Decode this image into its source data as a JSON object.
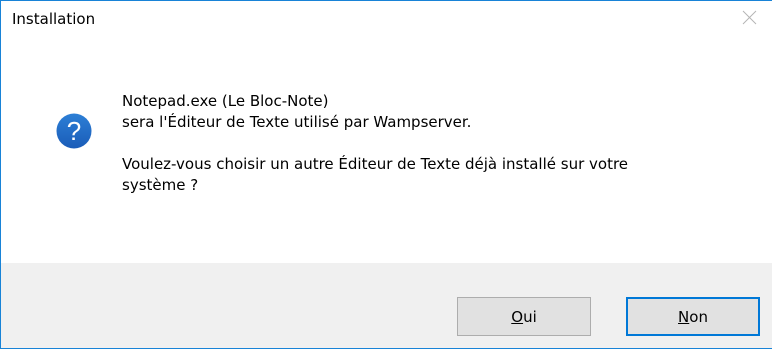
{
  "window": {
    "title": "Installation",
    "close_icon": "close-icon"
  },
  "message": {
    "line1": "Notepad.exe (Le Bloc-Note)",
    "line2": "sera l'Éditeur de Texte utilisé par Wampserver.",
    "line3": "Voulez-vous choisir un autre Éditeur de Texte déjà installé sur votre",
    "line4": "système ?",
    "icon": "question-icon"
  },
  "buttons": {
    "yes": {
      "accel": "O",
      "rest": "ui"
    },
    "no": {
      "accel": "N",
      "rest": "on"
    }
  },
  "colors": {
    "accent": "#0078d7",
    "icon_blue": "#1c64c1",
    "footer_bg": "#f0f0f0"
  }
}
